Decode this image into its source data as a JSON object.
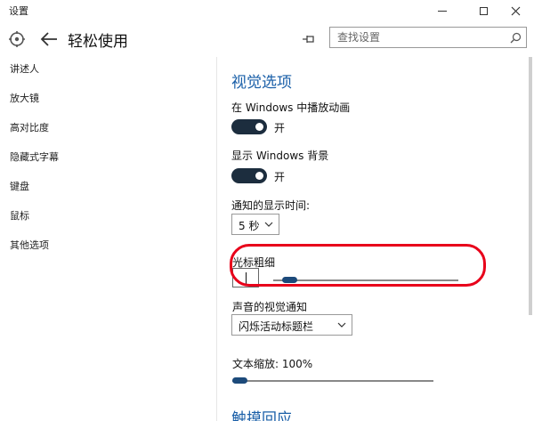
{
  "window": {
    "title": "设置",
    "min_glyph": "—",
    "max_glyph": "□",
    "close_glyph": "✕"
  },
  "header": {
    "title": "轻松使用",
    "search_placeholder": "查找设置"
  },
  "sidebar": {
    "items": [
      {
        "label": "讲述人"
      },
      {
        "label": "放大镜"
      },
      {
        "label": "高对比度"
      },
      {
        "label": "隐藏式字幕"
      },
      {
        "label": "键盘"
      },
      {
        "label": "鼠标"
      },
      {
        "label": "其他选项"
      }
    ]
  },
  "main": {
    "section_title": "视觉选项",
    "animations": {
      "label": "在 Windows 中播放动画",
      "state": "开"
    },
    "background": {
      "label": "显示 Windows 背景",
      "state": "开"
    },
    "notify_time": {
      "label": "通知的显示时间:",
      "value": "5 秒"
    },
    "cursor_thickness": {
      "label": "光标粗细",
      "value_fraction": 0.05
    },
    "visual_notify": {
      "label": "声音的视觉通知",
      "value": "闪烁活动标题栏"
    },
    "text_scale": {
      "label": "文本缩放: 100%",
      "value_fraction": 0.0
    },
    "next_section": "触摸回应"
  },
  "colors": {
    "accent": "#1a5fa8",
    "toggle_on": "#1c2d3e",
    "highlight": "#e8001a"
  },
  "icons": [
    "settings-gear-icon",
    "back-arrow-icon",
    "pin-icon",
    "search-icon",
    "chevron-down-icon"
  ]
}
